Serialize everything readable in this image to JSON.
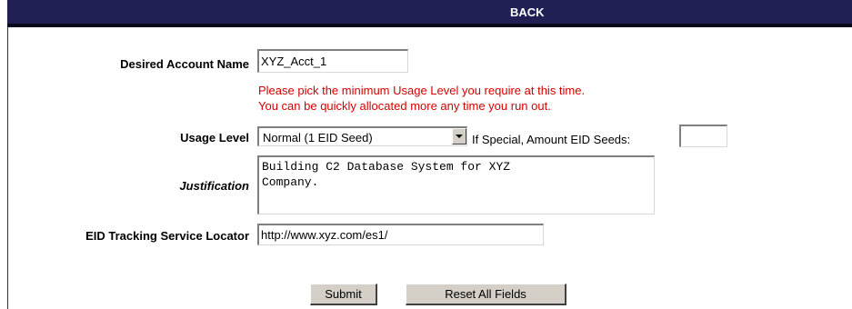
{
  "nav": {
    "back_label": "BACK"
  },
  "form": {
    "account_name": {
      "label": "Desired Account Name",
      "value": "XYZ_Acct_1"
    },
    "usage_note": {
      "line1": "Please pick the minimum Usage Level you require at this time.",
      "line2": "You can be quickly allocated more any time you run out."
    },
    "usage_level": {
      "label": "Usage Level",
      "selected": "Normal (1 EID Seed)",
      "special_label": "If Special, Amount EID Seeds:",
      "special_value": ""
    },
    "justification": {
      "label": "Justification",
      "value": "Building C2 Database System for XYZ\nCompany."
    },
    "eid_locator": {
      "label": "EID Tracking Service Locator",
      "value": "http://www.xyz.com/es1/"
    },
    "buttons": {
      "submit": "Submit",
      "reset": "Reset All Fields"
    }
  },
  "colors": {
    "header_bar": "#202055",
    "note_text": "#d40000",
    "button_face": "#d4d0c8"
  }
}
